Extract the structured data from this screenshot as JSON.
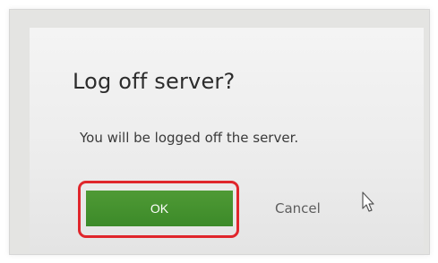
{
  "dialog": {
    "title": "Log off server?",
    "message": "You will be logged off the server.",
    "ok_label": "OK",
    "cancel_label": "Cancel"
  },
  "colors": {
    "ok_button": "#428f2d",
    "highlight": "#e0262c",
    "dialog_background": "#f0f0f0"
  },
  "icons": {
    "cursor": "mouse-pointer-icon"
  }
}
